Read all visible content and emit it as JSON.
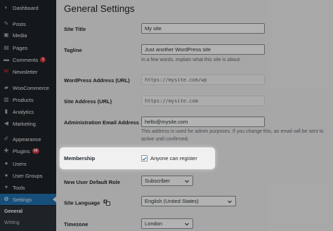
{
  "colors": {
    "sidebar_bg": "#1d2327",
    "active_bg": "#2271b1",
    "badge_bg": "#d63638",
    "content_bg": "#f0f0f1",
    "checkbox_check": "#2271b1"
  },
  "sidebar": {
    "items": [
      {
        "label": "Dashboard",
        "icon": "dashboard-icon",
        "glyph": "◐"
      },
      {
        "label": "Posts",
        "icon": "pin-icon",
        "glyph": "✎"
      },
      {
        "label": "Media",
        "icon": "media-icon",
        "glyph": "▣"
      },
      {
        "label": "Pages",
        "icon": "page-icon",
        "glyph": "▤"
      },
      {
        "label": "Comments",
        "icon": "comment-icon",
        "glyph": "▬",
        "badge": "1"
      },
      {
        "label": "Newsletter",
        "icon": "newsletter-icon",
        "glyph": "✉"
      },
      {
        "label": "WooCommerce",
        "icon": "woocommerce-icon",
        "glyph": "▰"
      },
      {
        "label": "Products",
        "icon": "products-icon",
        "glyph": "▥"
      },
      {
        "label": "Analytics",
        "icon": "analytics-icon",
        "glyph": "▮"
      },
      {
        "label": "Marketing",
        "icon": "megaphone-icon",
        "glyph": "◀"
      },
      {
        "label": "Appearance",
        "icon": "brush-icon",
        "glyph": "✐"
      },
      {
        "label": "Plugins",
        "icon": "plugin-icon",
        "glyph": "✚",
        "badge": "48"
      },
      {
        "label": "Users",
        "icon": "users-icon",
        "glyph": "●"
      },
      {
        "label": "User Groups",
        "icon": "user-groups-icon",
        "glyph": "●"
      },
      {
        "label": "Tools",
        "icon": "wrench-icon",
        "glyph": "✦"
      },
      {
        "label": "Settings",
        "icon": "settings-icon",
        "glyph": "⚙",
        "active": true
      }
    ],
    "submenu": [
      {
        "label": "General",
        "current": true
      },
      {
        "label": "Writing"
      }
    ]
  },
  "main": {
    "title": "General Settings",
    "site_title": {
      "label": "Site Title",
      "value": "My site"
    },
    "tagline": {
      "label": "Tagline",
      "value": "Just another WordPress site",
      "description": "In a few words, explain what this site is about."
    },
    "wordpress_address": {
      "label": "WordPress Address (URL)",
      "value": "https://mysite.com/wp"
    },
    "site_address": {
      "label": "Site Address (URL)",
      "value": "https://mysite.com"
    },
    "admin_email": {
      "label": "Administration Email Address",
      "value": "hello@mysite.com",
      "description_line1": "This address is used for admin purposes. If you change this, an email will be sent to",
      "description_line2": "active until confirmed."
    },
    "membership": {
      "label": "Membership",
      "checkbox_label": "Anyone can register",
      "checked": true
    },
    "default_role": {
      "label": "New User Default Role",
      "value": "Subscriber"
    },
    "site_language": {
      "label": "Site Language",
      "value": "English (United States)",
      "icon": "translation-icon"
    },
    "timezone": {
      "label": "Timezone",
      "value": "London"
    }
  }
}
